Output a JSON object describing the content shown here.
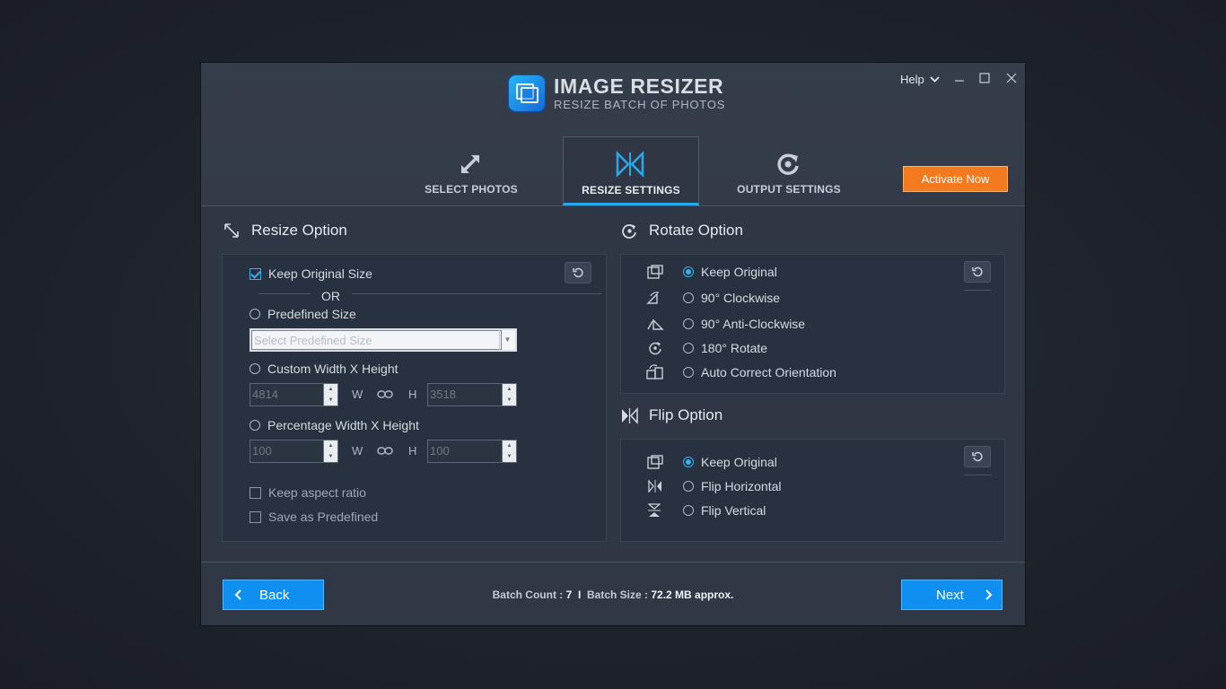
{
  "app": {
    "title": "IMAGE RESIZER",
    "subtitle": "RESIZE BATCH OF PHOTOS",
    "help_label": "Help",
    "accent_color": "#29a8ec",
    "brand_color": "#f37a1f"
  },
  "tabs": [
    {
      "label": "SELECT PHOTOS",
      "icon": "expand-arrows-icon",
      "active": false
    },
    {
      "label": "RESIZE SETTINGS",
      "icon": "resize-settings-icon",
      "active": true
    },
    {
      "label": "OUTPUT SETTINGS",
      "icon": "output-refresh-icon",
      "active": false
    }
  ],
  "activate_label": "Activate Now",
  "resize": {
    "title": "Resize Option",
    "keep_original": "Keep Original Size",
    "keep_original_checked": true,
    "or_label": "OR",
    "predefined_label": "Predefined Size",
    "predefined_placeholder": "Select Predefined Size",
    "custom_label": "Custom Width X Height",
    "custom_width": "4814",
    "custom_height": "3518",
    "w_label": "W",
    "h_label": "H",
    "percentage_label": "Percentage Width X Height",
    "percent_width": "100",
    "percent_height": "100",
    "keep_aspect": "Keep aspect ratio",
    "save_predefined": "Save as Predefined"
  },
  "rotate": {
    "title": "Rotate Option",
    "options": [
      {
        "label": "Keep Original",
        "icon": "image-original-icon",
        "selected": true
      },
      {
        "label": "90° Clockwise",
        "icon": "rotate-clockwise-icon",
        "selected": false
      },
      {
        "label": "90° Anti-Clockwise",
        "icon": "rotate-anticlockwise-icon",
        "selected": false
      },
      {
        "label": "180° Rotate",
        "icon": "rotate-180-icon",
        "selected": false
      },
      {
        "label": "Auto Correct Orientation",
        "icon": "auto-orient-icon",
        "selected": false
      }
    ]
  },
  "flip": {
    "title": "Flip Option",
    "options": [
      {
        "label": "Keep Original",
        "icon": "image-original-icon",
        "selected": true
      },
      {
        "label": "Flip Horizontal",
        "icon": "flip-horizontal-icon",
        "selected": false
      },
      {
        "label": "Flip Vertical",
        "icon": "flip-vertical-icon",
        "selected": false
      }
    ]
  },
  "footer": {
    "back_label": "Back",
    "next_label": "Next",
    "batch_count_label": "Batch Count :",
    "batch_count": "7",
    "separator": "I",
    "batch_size_label": "Batch Size :",
    "batch_size": "72.2 MB approx."
  }
}
